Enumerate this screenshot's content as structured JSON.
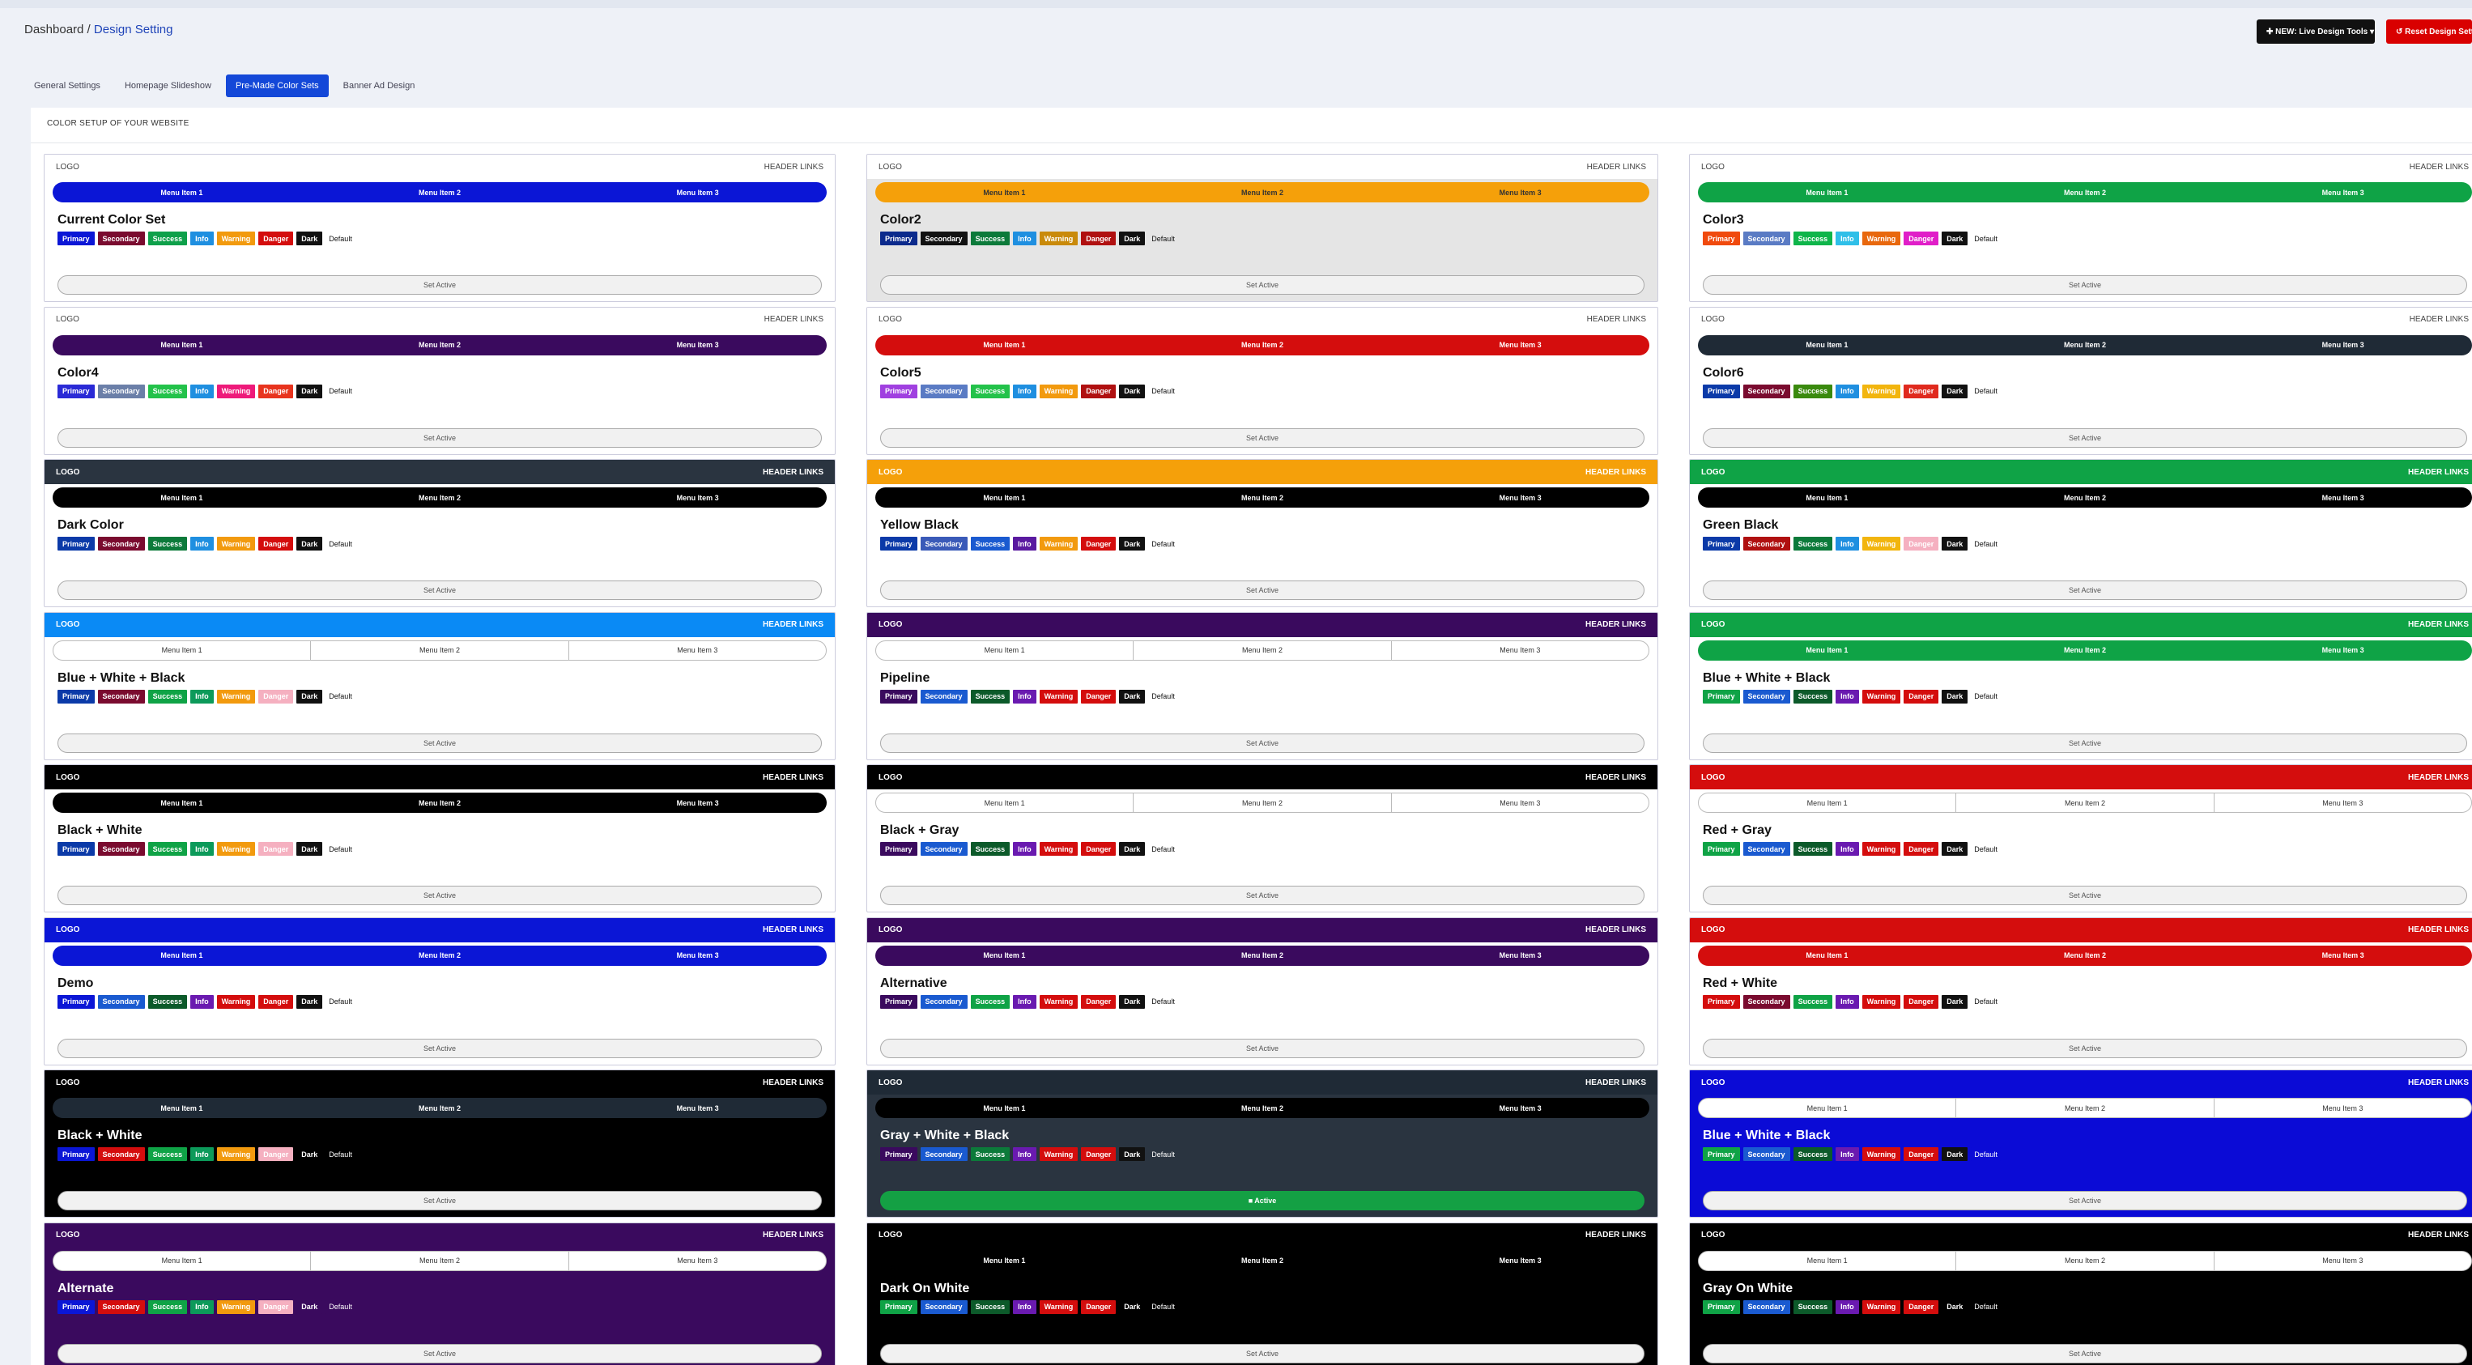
{
  "breadcrumb": {
    "home": "Dashboard",
    "sep": " / ",
    "current": "Design Setting"
  },
  "toolbar": {
    "live_tools_label": "✚ NEW: Live Design Tools ▾",
    "reset_label": "↺ Reset Design Settings"
  },
  "tabs": [
    {
      "label": "General Settings",
      "active": false
    },
    {
      "label": "Homepage Slideshow",
      "active": false
    },
    {
      "label": "Pre-Made Color Sets",
      "active": true
    },
    {
      "label": "Banner Ad Design",
      "active": false
    }
  ],
  "section_title": "COLOR SETUP OF YOUR WEBSITE",
  "card_labels": {
    "logo": "LOGO",
    "header_links": "HEADER LINKS",
    "menu_items": [
      "Menu Item 1",
      "Menu Item 2",
      "Menu Item 3"
    ],
    "set_active": "Set Active",
    "active": "■ Active"
  },
  "swatch_labels": [
    "Primary",
    "Secondary",
    "Success",
    "Info",
    "Warning",
    "Danger",
    "Dark",
    "Default"
  ],
  "color_sets": [
    {
      "name": "Current Color Set",
      "header_bg": "#ffffff",
      "header_fg": "#444444",
      "menu_bg": "#0b16d6",
      "menu_fg": "#ffffff",
      "menu_style": "fill",
      "body_bg": "#ffffff",
      "body_fg": "#111111",
      "swatches": [
        "#0b16d6",
        "#7a0b2f",
        "#0ea04a",
        "#1f8fe0",
        "#f29a0e",
        "#d40d0d",
        "#111111",
        "#ffffff"
      ],
      "active": false
    },
    {
      "name": "Color2",
      "header_bg": "#ffffff",
      "header_fg": "#444444",
      "menu_bg": "#f5a00a",
      "menu_fg": "#333333",
      "menu_style": "fill",
      "body_bg": "#e5e5e5",
      "body_fg": "#111111",
      "swatches": [
        "#0b2a8c",
        "#111111",
        "#0c7a3a",
        "#1f8fe0",
        "#c98a0a",
        "#b01010",
        "#111111",
        "#e5e5e5"
      ],
      "active": false
    },
    {
      "name": "Color3",
      "header_bg": "#ffffff",
      "header_fg": "#444444",
      "menu_bg": "#0fa346",
      "menu_fg": "#ffffff",
      "menu_style": "fill",
      "body_bg": "#ffffff",
      "body_fg": "#111111",
      "swatches": [
        "#f04a0e",
        "#5a7bc4",
        "#0fb54a",
        "#2fbfe8",
        "#e8680e",
        "#e01ec8",
        "#111111",
        "#ffffff"
      ],
      "active": false
    },
    {
      "name": "Color4",
      "header_bg": "#ffffff",
      "header_fg": "#444444",
      "menu_bg": "#3a0a5e",
      "menu_fg": "#ffffff",
      "menu_style": "fill",
      "body_bg": "#ffffff",
      "body_fg": "#111111",
      "swatches": [
        "#2a2ad6",
        "#6b7fa8",
        "#23c24a",
        "#1f8fe0",
        "#ee1a7a",
        "#e8341e",
        "#111111",
        "#ffffff"
      ],
      "active": false
    },
    {
      "name": "Color5",
      "header_bg": "#ffffff",
      "header_fg": "#444444",
      "menu_bg": "#d40d0d",
      "menu_fg": "#ffffff",
      "menu_style": "fill",
      "body_bg": "#ffffff",
      "body_fg": "#111111",
      "swatches": [
        "#a040e0",
        "#5a7bc4",
        "#23c24a",
        "#1f8fe0",
        "#f29a0e",
        "#b01010",
        "#111111",
        "#ffffff"
      ],
      "active": false
    },
    {
      "name": "Color6",
      "header_bg": "#ffffff",
      "header_fg": "#444444",
      "menu_bg": "#1f2a36",
      "menu_fg": "#ffffff",
      "menu_style": "fill",
      "body_bg": "#ffffff",
      "body_fg": "#111111",
      "swatches": [
        "#0b3aa8",
        "#7a0b2f",
        "#3a8a0e",
        "#1f8fe0",
        "#f2b50e",
        "#e02a1e",
        "#111111",
        "#ffffff"
      ],
      "active": false
    },
    {
      "name": "Dark Color",
      "header_bg": "#2a3440",
      "header_fg": "#ffffff",
      "menu_bg": "#000000",
      "menu_fg": "#ffffff",
      "menu_style": "fill",
      "body_bg": "#ffffff",
      "body_fg": "#111111",
      "swatches": [
        "#0b3aa8",
        "#7a0b2f",
        "#0c7a3a",
        "#1f8fe0",
        "#f29a0e",
        "#d40d0d",
        "#111111",
        "#ffffff"
      ],
      "active": false
    },
    {
      "name": "Yellow Black",
      "header_bg": "#f5a00a",
      "header_fg": "#ffffff",
      "menu_bg": "#000000",
      "menu_fg": "#ffffff",
      "menu_style": "fill",
      "body_bg": "#ffffff",
      "body_fg": "#111111",
      "swatches": [
        "#0b3aa8",
        "#3a5ab8",
        "#1a5ad0",
        "#5a1aa0",
        "#f29a0e",
        "#d40d0d",
        "#111111",
        "#ffffff"
      ],
      "active": false
    },
    {
      "name": "Green Black",
      "header_bg": "#0fa346",
      "header_fg": "#ffffff",
      "menu_bg": "#000000",
      "menu_fg": "#ffffff",
      "menu_style": "fill",
      "body_bg": "#ffffff",
      "body_fg": "#111111",
      "swatches": [
        "#0b3aa8",
        "#b01010",
        "#0c7a3a",
        "#1f8fe0",
        "#f2b50e",
        "#f5b0c0",
        "#111111",
        "#ffffff"
      ],
      "active": false
    },
    {
      "name": "Blue + White + Black",
      "header_bg": "#0a8af5",
      "header_fg": "#ffffff",
      "menu_bg": "#ffffff",
      "menu_fg": "#333333",
      "menu_style": "outline",
      "body_bg": "#ffffff",
      "body_fg": "#111111",
      "swatches": [
        "#0b3aa8",
        "#7a0b2f",
        "#0fa346",
        "#0c9a5a",
        "#f29a0e",
        "#f5b0c0",
        "#111111",
        "#ffffff"
      ],
      "active": false
    },
    {
      "name": "Pipeline",
      "header_bg": "#3a0a5e",
      "header_fg": "#ffffff",
      "menu_bg": "#ffffff",
      "menu_fg": "#333333",
      "menu_style": "outline",
      "body_bg": "#ffffff",
      "body_fg": "#111111",
      "swatches": [
        "#3a0a5e",
        "#1a5ad0",
        "#0c5a2a",
        "#6a1ab0",
        "#d40d0d",
        "#d40d0d",
        "#111111",
        "#ffffff"
      ],
      "active": false
    },
    {
      "name": "Blue + White + Black",
      "header_bg": "#0fa346",
      "header_fg": "#ffffff",
      "menu_bg": "#0fa346",
      "menu_fg": "#ffffff",
      "menu_style": "fill",
      "body_bg": "#ffffff",
      "body_fg": "#111111",
      "swatches": [
        "#0fa346",
        "#1a5ad0",
        "#0c5a2a",
        "#6a1ab0",
        "#d40d0d",
        "#d40d0d",
        "#111111",
        "#ffffff"
      ],
      "active": false
    },
    {
      "name": "Black + White",
      "header_bg": "#000000",
      "header_fg": "#ffffff",
      "menu_bg": "#000000",
      "menu_fg": "#ffffff",
      "menu_style": "fill",
      "body_bg": "#ffffff",
      "body_fg": "#111111",
      "swatches": [
        "#0b3aa8",
        "#7a0b2f",
        "#0fa346",
        "#0c9a5a",
        "#f29a0e",
        "#f5b0c0",
        "#111111",
        "#ffffff"
      ],
      "active": false
    },
    {
      "name": "Black + Gray",
      "header_bg": "#000000",
      "header_fg": "#ffffff",
      "menu_bg": "#ffffff",
      "menu_fg": "#333333",
      "menu_style": "outline",
      "body_bg": "#ffffff",
      "body_fg": "#111111",
      "swatches": [
        "#3a0a5e",
        "#1a5ad0",
        "#0c5a2a",
        "#6a1ab0",
        "#d40d0d",
        "#d40d0d",
        "#111111",
        "#ffffff"
      ],
      "active": false
    },
    {
      "name": "Red + Gray",
      "header_bg": "#d40d0d",
      "header_fg": "#ffffff",
      "menu_bg": "#ffffff",
      "menu_fg": "#333333",
      "menu_style": "outline",
      "body_bg": "#ffffff",
      "body_fg": "#111111",
      "swatches": [
        "#0fa346",
        "#1a5ad0",
        "#0c5a2a",
        "#6a1ab0",
        "#d40d0d",
        "#d40d0d",
        "#111111",
        "#ffffff"
      ],
      "active": false
    },
    {
      "name": "Demo",
      "header_bg": "#0b16d6",
      "header_fg": "#ffffff",
      "menu_bg": "#0b16d6",
      "menu_fg": "#ffffff",
      "menu_style": "fill",
      "body_bg": "#ffffff",
      "body_fg": "#111111",
      "swatches": [
        "#0b16d6",
        "#1a5ad0",
        "#0c5a2a",
        "#6a1ab0",
        "#d40d0d",
        "#d40d0d",
        "#111111",
        "#ffffff"
      ],
      "active": false
    },
    {
      "name": "Alternative",
      "header_bg": "#3a0a5e",
      "header_fg": "#ffffff",
      "menu_bg": "#3a0a5e",
      "menu_fg": "#ffffff",
      "menu_style": "fill",
      "body_bg": "#ffffff",
      "body_fg": "#111111",
      "swatches": [
        "#3a0a5e",
        "#1a5ad0",
        "#0fa346",
        "#6a1ab0",
        "#d40d0d",
        "#d40d0d",
        "#111111",
        "#ffffff"
      ],
      "active": false
    },
    {
      "name": "Red + White",
      "header_bg": "#d40d0d",
      "header_fg": "#ffffff",
      "menu_bg": "#d40d0d",
      "menu_fg": "#ffffff",
      "menu_style": "fill",
      "body_bg": "#ffffff",
      "body_fg": "#111111",
      "swatches": [
        "#d40d0d",
        "#7a0b2f",
        "#0fa346",
        "#6a1ab0",
        "#d40d0d",
        "#d40d0d",
        "#111111",
        "#ffffff"
      ],
      "active": false
    },
    {
      "name": "Black + White",
      "header_bg": "#000000",
      "header_fg": "#ffffff",
      "menu_bg": "#1f2a36",
      "menu_fg": "#ffffff",
      "menu_style": "fill",
      "body_bg": "#000000",
      "body_fg": "#ffffff",
      "swatches": [
        "#0b16d6",
        "#d40d0d",
        "#0fa346",
        "#0c9a5a",
        "#f29a0e",
        "#f5b0c0",
        "#000000",
        "#000000"
      ],
      "active": false
    },
    {
      "name": "Gray + White + Black",
      "header_bg": "#1f2a36",
      "header_fg": "#ffffff",
      "menu_bg": "#000000",
      "menu_fg": "#ffffff",
      "menu_style": "fill",
      "body_bg": "#2a3440",
      "body_fg": "#ffffff",
      "swatches": [
        "#3a0a5e",
        "#1a5ad0",
        "#0c7a3a",
        "#6a1ab0",
        "#d40d0d",
        "#d40d0d",
        "#111111",
        "#2a3440"
      ],
      "active": true
    },
    {
      "name": "Blue + White + Black",
      "header_bg": "#0b0bd6",
      "header_fg": "#ffffff",
      "menu_bg": "#ffffff",
      "menu_fg": "#333333",
      "menu_style": "outline",
      "body_bg": "#0b0bd6",
      "body_fg": "#ffffff",
      "swatches": [
        "#0fa346",
        "#1a5ad0",
        "#0c5a2a",
        "#6a1ab0",
        "#d40d0d",
        "#d40d0d",
        "#111111",
        "#0b0bd6"
      ],
      "active": false
    },
    {
      "name": "Alternate",
      "header_bg": "#3a0a5e",
      "header_fg": "#ffffff",
      "menu_bg": "#ffffff",
      "menu_fg": "#333333",
      "menu_style": "outline",
      "body_bg": "#3a0a5e",
      "body_fg": "#ffffff",
      "swatches": [
        "#0b16d6",
        "#d40d0d",
        "#0fa346",
        "#0c9a5a",
        "#f29a0e",
        "#f5b0c0",
        "#3a0a5e",
        "#3a0a5e"
      ],
      "active": false
    },
    {
      "name": "Dark On White",
      "header_bg": "#000000",
      "header_fg": "#ffffff",
      "menu_bg": "#000000",
      "menu_fg": "#ffffff",
      "menu_style": "fill",
      "body_bg": "#000000",
      "body_fg": "#ffffff",
      "swatches": [
        "#0fa346",
        "#1a5ad0",
        "#0c5a2a",
        "#6a1ab0",
        "#d40d0d",
        "#d40d0d",
        "#000000",
        "#000000"
      ],
      "active": false
    },
    {
      "name": "Gray On White",
      "header_bg": "#000000",
      "header_fg": "#ffffff",
      "menu_bg": "#ffffff",
      "menu_fg": "#333333",
      "menu_style": "outline",
      "body_bg": "#000000",
      "body_fg": "#ffffff",
      "swatches": [
        "#0fa346",
        "#1a5ad0",
        "#0c5a2a",
        "#6a1ab0",
        "#d40d0d",
        "#d40d0d",
        "#000000",
        "#000000"
      ],
      "active": false
    }
  ]
}
